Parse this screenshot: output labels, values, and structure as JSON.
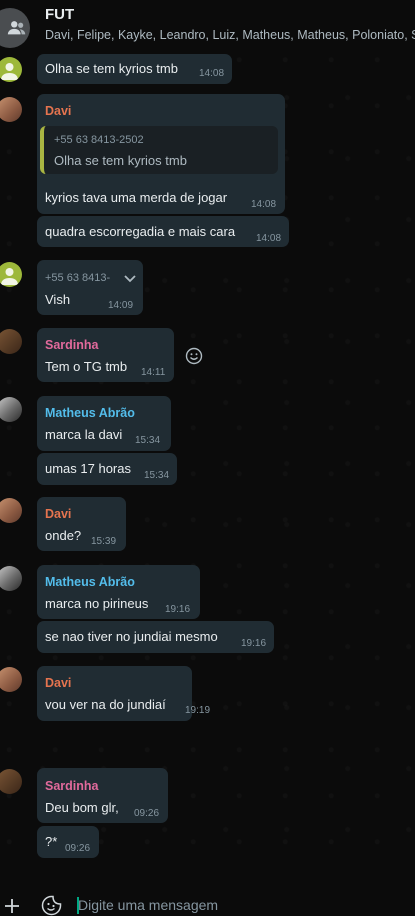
{
  "header": {
    "title": "FUT",
    "members": "Davi, Felipe, Kayke, Leandro, Luiz, Matheus, Matheus, Poloniato, S"
  },
  "messages": [
    {
      "text": "Olha se tem kyrios tmb",
      "time": "14:08"
    },
    {
      "sender": "Davi",
      "quote_phone": "+55 63 8413-2502",
      "quote_text": "Olha se tem kyrios tmb",
      "text": "kyrios tava uma merda de jogar",
      "time": "14:08"
    },
    {
      "text": "quadra escorregadia e mais cara",
      "time": "14:08"
    },
    {
      "sender_phone": "+55 63 8413-",
      "text": "Vish",
      "time": "14:09"
    },
    {
      "sender": "Sardinha",
      "text": "Tem o TG tmb",
      "time": "14:11"
    },
    {
      "sender": "Matheus Abrão",
      "text": "marca la davi",
      "time": "15:34"
    },
    {
      "text": "umas 17 horas",
      "time": "15:34"
    },
    {
      "sender": "Davi",
      "text": "onde?",
      "time": "15:39"
    },
    {
      "sender": "Matheus Abrão",
      "text": "marca no pirineus",
      "time": "19:16"
    },
    {
      "text": "se nao tiver no jundiai mesmo",
      "time": "19:16"
    },
    {
      "sender": "Davi",
      "text": "vou ver na do jundiaí",
      "time": "19:19"
    },
    {
      "sender": "Sardinha",
      "text": "Deu bom glr,",
      "time": "09:26"
    },
    {
      "text": "?*",
      "time": "09:26"
    }
  ],
  "composer": {
    "placeholder": "Digite uma mensagem"
  },
  "icons": {
    "group": "group-icon",
    "emoji_reaction": "emoji-icon",
    "dropdown": "chevron-down-icon",
    "attach": "plus-icon",
    "sticker": "sticker-icon"
  },
  "colors": {
    "davi": "#e5744f",
    "sardinha": "#e26a9c",
    "matheus": "#53bdeb",
    "bubble": "#202c33",
    "accent": "#00a884"
  }
}
